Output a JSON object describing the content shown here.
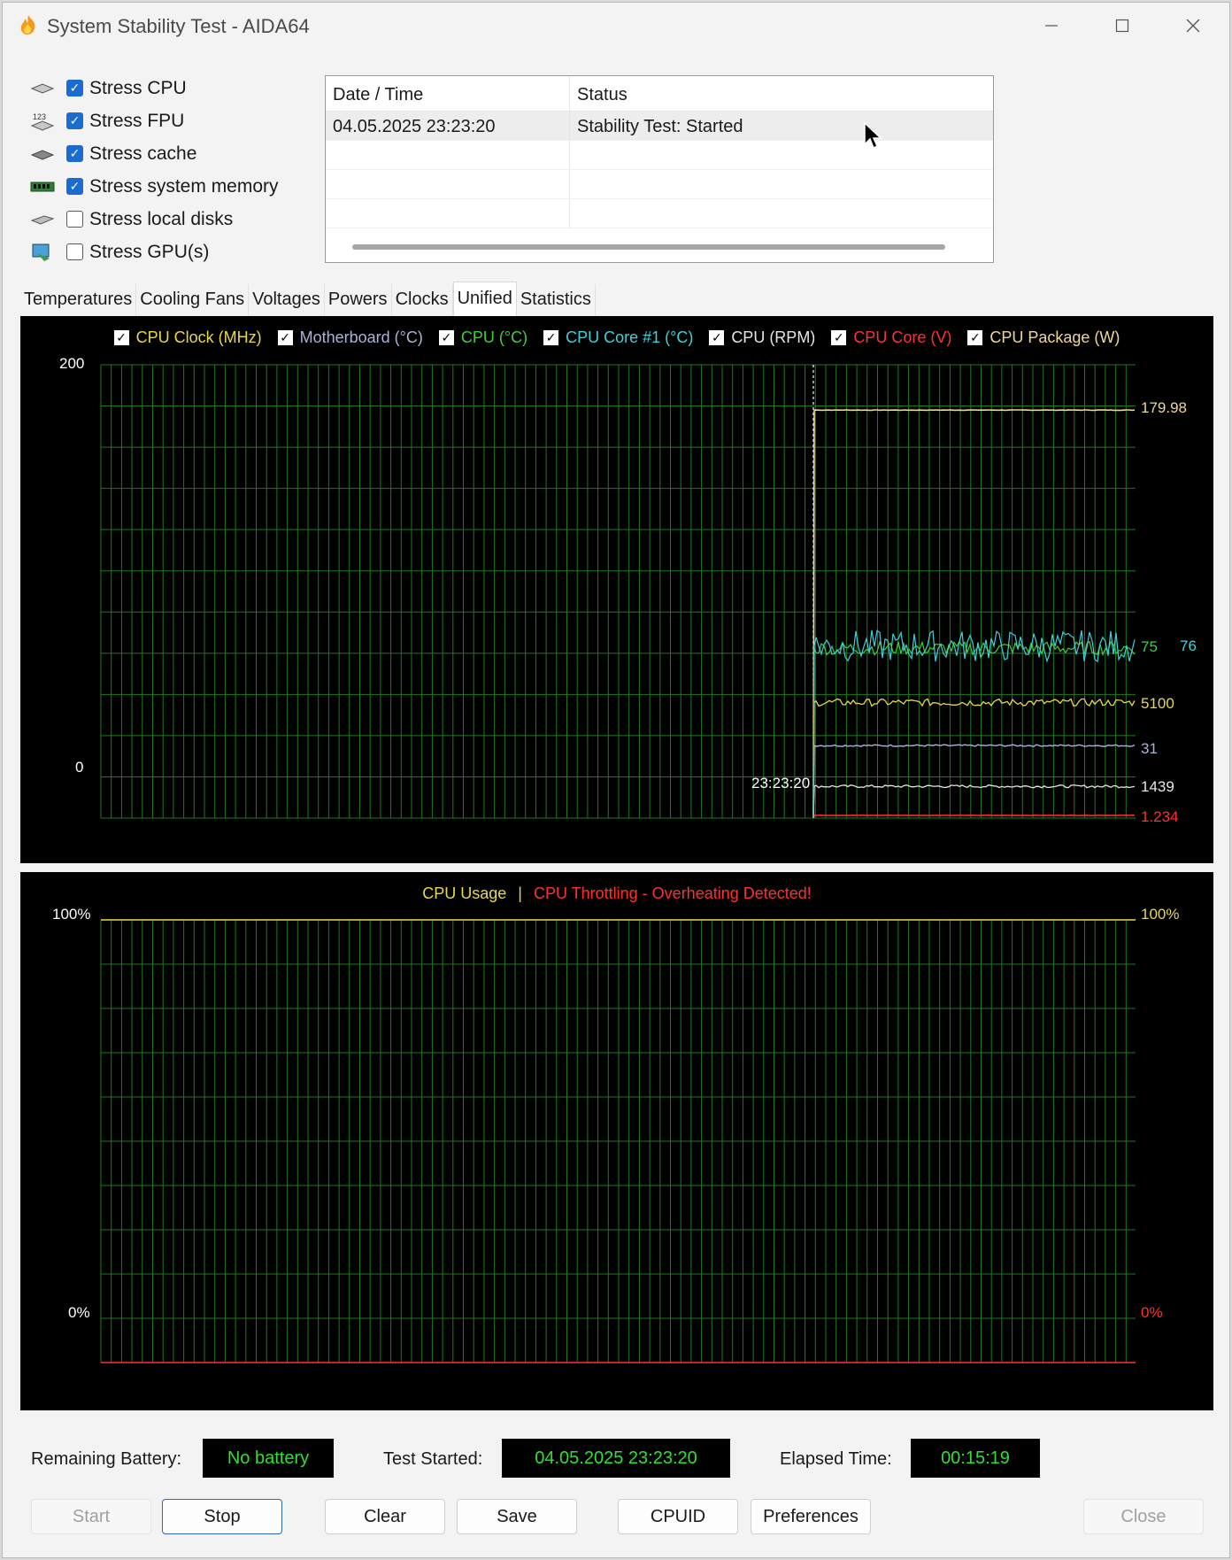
{
  "window": {
    "title": "System Stability Test - AIDA64",
    "controls": {
      "minimize": "—",
      "maximize": "☐",
      "close": "✕"
    }
  },
  "stress_options": [
    {
      "label": "Stress CPU",
      "checked": true,
      "icon": "cpu-icon"
    },
    {
      "label": "Stress FPU",
      "checked": true,
      "icon": "fpu-icon"
    },
    {
      "label": "Stress cache",
      "checked": true,
      "icon": "cache-icon"
    },
    {
      "label": "Stress system memory",
      "checked": true,
      "icon": "memory-icon"
    },
    {
      "label": "Stress local disks",
      "checked": false,
      "icon": "disk-icon"
    },
    {
      "label": "Stress GPU(s)",
      "checked": false,
      "icon": "gpu-icon"
    }
  ],
  "log": {
    "headers": [
      "Date / Time",
      "Status"
    ],
    "rows": [
      [
        "04.05.2025 23:23:20",
        "Stability Test: Started"
      ],
      [
        "",
        ""
      ],
      [
        "",
        ""
      ],
      [
        "",
        ""
      ]
    ]
  },
  "tabs": [
    "Temperatures",
    "Cooling Fans",
    "Voltages",
    "Powers",
    "Clocks",
    "Unified",
    "Statistics"
  ],
  "active_tab": "Unified",
  "graph1": {
    "legend": [
      {
        "label": "CPU Clock (MHz)",
        "color": "#e8d84a",
        "checked": true
      },
      {
        "label": "Motherboard (°C)",
        "color": "#a9b4d8",
        "checked": true
      },
      {
        "label": "CPU (°C)",
        "color": "#3ecf3e",
        "checked": true
      },
      {
        "label": "CPU Core #1 (°C)",
        "color": "#3fd0d8",
        "checked": true
      },
      {
        "label": "CPU (RPM)",
        "color": "#e6e6e6",
        "checked": true
      },
      {
        "label": "CPU Core (V)",
        "color": "#ff3030",
        "checked": true
      },
      {
        "label": "CPU Package (W)",
        "color": "#f0d890",
        "checked": true
      }
    ],
    "y_max": "200",
    "y_min": "0",
    "x_label": "23:23:20",
    "value_labels": [
      {
        "text": "179.98",
        "color": "#f0d890"
      },
      {
        "text": "75",
        "color": "#3ecf3e"
      },
      {
        "text": "76",
        "color": "#3fd0d8"
      },
      {
        "text": "5100",
        "color": "#e8d84a"
      },
      {
        "text": "31",
        "color": "#a9b4d8"
      },
      {
        "text": "1439",
        "color": "#e6e6e6"
      },
      {
        "text": "1.234",
        "color": "#ff3030"
      }
    ],
    "grid_color": "#1f7a1f"
  },
  "graph2": {
    "title_left": "CPU Usage",
    "title_sep": "|",
    "title_right": "CPU Throttling - Overheating Detected!",
    "left_top": "100%",
    "left_bottom": "0%",
    "right_top": "100%",
    "right_bottom": "0%",
    "color_usage": "#e8d84a",
    "color_throttle": "#ff3030"
  },
  "chart_data": [
    {
      "type": "line",
      "ylim": [
        0,
        200
      ],
      "series": [
        {
          "name": "CPU Package (W)",
          "last": 179.98,
          "approx_plotted": 180
        },
        {
          "name": "CPU (°C)",
          "last": 75,
          "approx_plotted": 75
        },
        {
          "name": "CPU Core #1 (°C)",
          "last": 76,
          "approx_plotted": 76
        },
        {
          "name": "CPU Clock (MHz)",
          "last": 5100,
          "approx_plotted": 51
        },
        {
          "name": "Motherboard (°C)",
          "last": 31,
          "approx_plotted": 32
        },
        {
          "name": "CPU (RPM)",
          "last": 1439,
          "approx_plotted": 14
        },
        {
          "name": "CPU Core (V)",
          "last": 1.234,
          "approx_plotted": 1.2
        }
      ],
      "xlabel": "23:23:20"
    },
    {
      "type": "line",
      "ylim": [
        0,
        100
      ],
      "series": [
        {
          "name": "CPU Usage",
          "values": []
        },
        {
          "name": "CPU Throttling",
          "values": []
        }
      ]
    }
  ],
  "status": {
    "battery_label": "Remaining Battery:",
    "battery_value": "No battery",
    "started_label": "Test Started:",
    "started_value": "04.05.2025 23:23:20",
    "elapsed_label": "Elapsed Time:",
    "elapsed_value": "00:15:19"
  },
  "buttons": {
    "start": "Start",
    "stop": "Stop",
    "clear": "Clear",
    "save": "Save",
    "cpuid": "CPUID",
    "preferences": "Preferences",
    "close": "Close"
  }
}
